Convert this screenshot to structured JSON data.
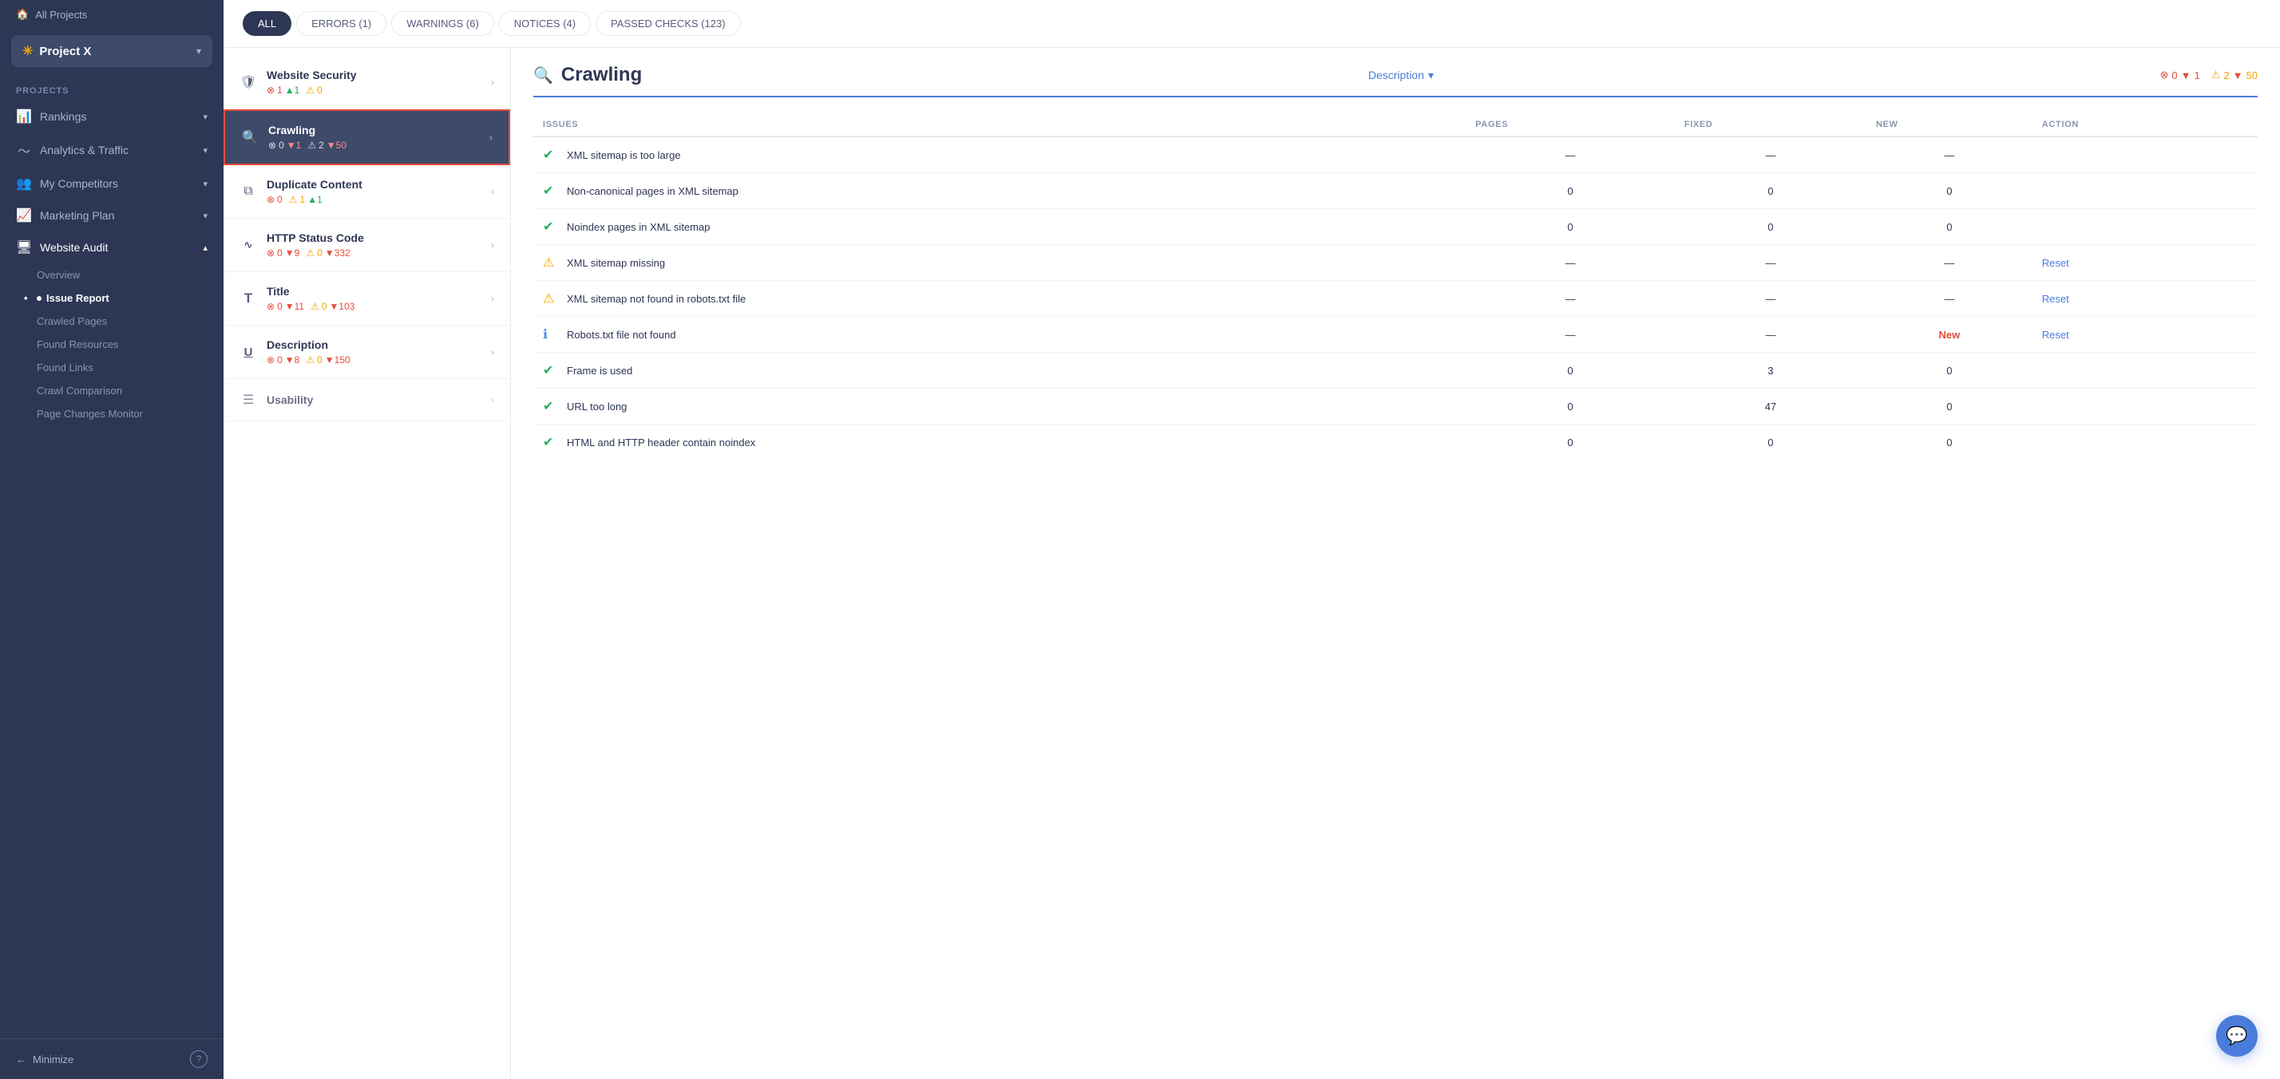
{
  "sidebar": {
    "all_projects_label": "All Projects",
    "project_name": "Project X",
    "section_label": "PROJECTS",
    "nav_items": [
      {
        "id": "rankings",
        "label": "Rankings",
        "has_chevron": true
      },
      {
        "id": "analytics",
        "label": "Analytics & Traffic",
        "has_chevron": true
      },
      {
        "id": "competitors",
        "label": "My Competitors",
        "has_chevron": true
      },
      {
        "id": "marketing",
        "label": "Marketing Plan",
        "has_chevron": true
      },
      {
        "id": "audit",
        "label": "Website Audit",
        "has_chevron": true,
        "active": true
      }
    ],
    "sub_items": [
      {
        "id": "overview",
        "label": "Overview",
        "active": false
      },
      {
        "id": "issue-report",
        "label": "Issue Report",
        "active": true
      },
      {
        "id": "crawled-pages",
        "label": "Crawled Pages",
        "active": false
      },
      {
        "id": "found-resources",
        "label": "Found Resources",
        "active": false
      },
      {
        "id": "found-links",
        "label": "Found Links",
        "active": false
      },
      {
        "id": "crawl-comparison",
        "label": "Crawl Comparison",
        "active": false
      },
      {
        "id": "page-changes",
        "label": "Page Changes Monitor",
        "active": false
      }
    ],
    "minimize_label": "Minimize"
  },
  "filter_bar": {
    "buttons": [
      {
        "id": "all",
        "label": "ALL",
        "active": true
      },
      {
        "id": "errors",
        "label": "ERRORS (1)",
        "active": false
      },
      {
        "id": "warnings",
        "label": "WARNINGS (6)",
        "active": false
      },
      {
        "id": "notices",
        "label": "NOTICES (4)",
        "active": false
      },
      {
        "id": "passed",
        "label": "PASSED CHECKS (123)",
        "active": false
      }
    ]
  },
  "categories": [
    {
      "id": "website-security",
      "icon": "🛡",
      "title": "Website Security",
      "stats": {
        "errors": "1",
        "errors_up": "1",
        "warnings": "0"
      }
    },
    {
      "id": "crawling",
      "icon": "🔍",
      "title": "Crawling",
      "selected": true,
      "stats": {
        "errors": "0",
        "errors_down": "1",
        "warnings": "2",
        "warnings_down": "50"
      }
    },
    {
      "id": "duplicate-content",
      "icon": "📋",
      "title": "Duplicate Content",
      "stats": {
        "errors": "0",
        "warnings": "1",
        "warnings_up": "1"
      }
    },
    {
      "id": "http-status",
      "icon": "〜",
      "title": "HTTP Status Code",
      "stats": {
        "errors": "0",
        "errors_down": "9",
        "warnings": "0",
        "warnings_down": "332"
      }
    },
    {
      "id": "title",
      "icon": "T",
      "title": "Title",
      "stats": {
        "errors": "0",
        "errors_down": "11",
        "warnings": "0",
        "warnings_down": "103"
      }
    },
    {
      "id": "description",
      "icon": "U",
      "title": "Description",
      "stats": {
        "errors": "0",
        "errors_down": "8",
        "warnings": "0",
        "warnings_down": "150"
      }
    },
    {
      "id": "usability",
      "icon": "☰",
      "title": "Usability",
      "stats": {}
    }
  ],
  "table": {
    "title": "Crawling",
    "description_label": "Description",
    "stats": {
      "errors": "0",
      "errors_down": "1",
      "warnings": "2",
      "warnings_down": "50"
    },
    "columns": [
      "ISSUES",
      "PAGES",
      "FIXED",
      "NEW",
      "ACTION"
    ],
    "rows": [
      {
        "status": "check",
        "issue": "XML sitemap is too large",
        "pages": "—",
        "fixed": "—",
        "new": "—",
        "action": ""
      },
      {
        "status": "check",
        "issue": "Non-canonical pages in XML sitemap",
        "pages": "0",
        "fixed": "0",
        "new": "0",
        "action": ""
      },
      {
        "status": "check",
        "issue": "Noindex pages in XML sitemap",
        "pages": "0",
        "fixed": "0",
        "new": "0",
        "action": ""
      },
      {
        "status": "warn",
        "issue": "XML sitemap missing",
        "pages": "—",
        "fixed": "—",
        "new": "—",
        "action": "Reset"
      },
      {
        "status": "warn",
        "issue": "XML sitemap not found in robots.txt file",
        "pages": "—",
        "fixed": "—",
        "new": "—",
        "action": "Reset"
      },
      {
        "status": "info",
        "issue": "Robots.txt file not found",
        "pages": "—",
        "fixed": "—",
        "new": "New",
        "new_type": "new",
        "action": "Reset"
      },
      {
        "status": "check",
        "issue": "Frame is used",
        "pages": "0",
        "fixed": "3",
        "new": "0",
        "action": ""
      },
      {
        "status": "check",
        "issue": "URL too long",
        "pages": "0",
        "fixed": "47",
        "new": "0",
        "action": ""
      },
      {
        "status": "check",
        "issue": "HTML and HTTP header contain noindex",
        "pages": "0",
        "fixed": "0",
        "new": "0",
        "action": ""
      }
    ]
  },
  "chat_button_icon": "💬"
}
